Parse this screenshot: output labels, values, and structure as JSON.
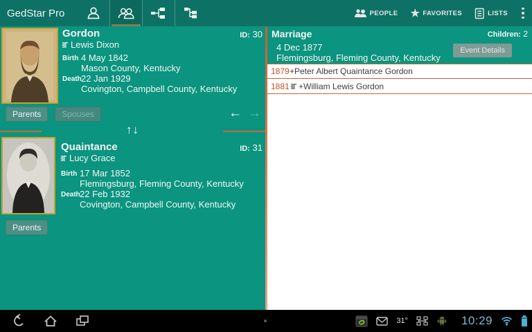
{
  "app_title": "GedStar Pro",
  "actionbar": {
    "tabs": [
      {
        "icon": "person-icon",
        "selected": false
      },
      {
        "icon": "couple-icon",
        "selected": true
      },
      {
        "icon": "ancestors-chart-icon",
        "selected": false
      },
      {
        "icon": "descendants-tree-icon",
        "selected": false
      }
    ],
    "actions": [
      {
        "icon": "people-icon",
        "label": "PEOPLE"
      },
      {
        "icon": "star-icon",
        "label": "FAVORITES"
      },
      {
        "icon": "lists-icon",
        "label": "LISTS"
      }
    ]
  },
  "person_panel": {
    "person1": {
      "surname": "Gordon",
      "id_label": "ID:",
      "id_value": "30",
      "given_name": "Lewis Dixon",
      "birth_label": "Birth",
      "birth_date": "4 May 1842",
      "birth_place": "Mason County, Kentucky",
      "death_label": "Death",
      "death_date": "22 Jan 1929",
      "death_place": "Covington, Campbell County, Kentucky",
      "parents_button": "Parents",
      "spouses_button": "Spouses"
    },
    "person2": {
      "surname": "Quaintance",
      "id_label": "ID:",
      "id_value": "31",
      "given_name": "Lucy Grace",
      "birth_label": "Birth",
      "birth_date": "17 Mar 1852",
      "birth_place": "Flemingsburg, Fleming County, Kentucky",
      "death_label": "Death",
      "death_date": "22 Feb 1932",
      "death_place": "Covington, Campbell County, Kentucky",
      "parents_button": "Parents"
    }
  },
  "marriage_panel": {
    "title": "Marriage",
    "children_label": "Children:",
    "children_count": "2",
    "event_date": "4 Dec 1877",
    "event_place": "Flemingsburg, Fleming County, Kentucky",
    "event_details_button": "Event Details",
    "children": [
      {
        "year": "1879",
        "name": "+Peter Albert Quaintance Gordon"
      },
      {
        "year": "1881",
        "name": "+William Lewis Gordon"
      }
    ]
  },
  "system_bar": {
    "temperature": "31°",
    "time": "10:29"
  },
  "glyphs": {
    "star": "★",
    "prev": "←",
    "next": "→",
    "updown": "↑↓"
  },
  "colors": {
    "actionbar_bg": "#0d7265",
    "panel_teal": "#0b9480",
    "accent_orange": "#c95f2e",
    "photo_border_gold": "#c9a227",
    "status_blue": "#84b6cd",
    "tab_underline": "#847d4b"
  }
}
